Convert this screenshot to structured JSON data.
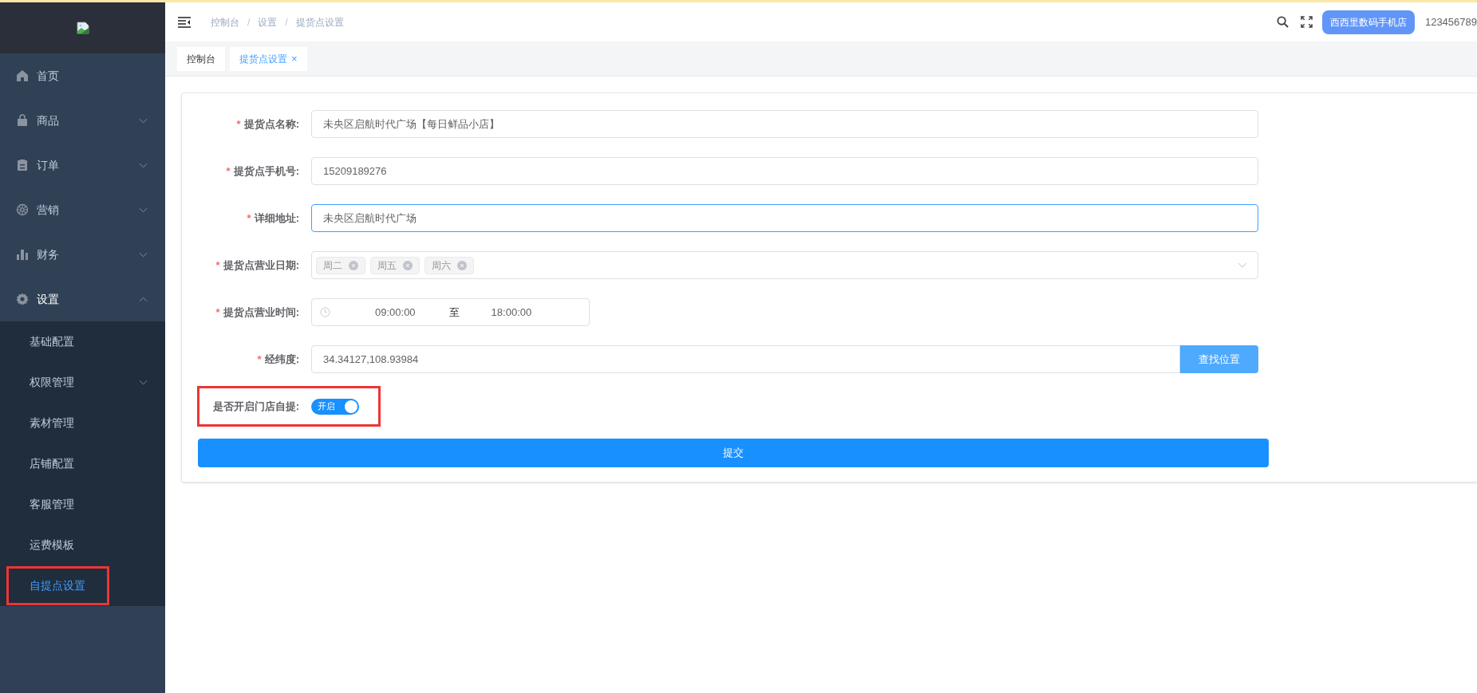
{
  "sidebar": {
    "logo": {
      "kind": "broken-image"
    },
    "items": [
      {
        "label": "首页"
      },
      {
        "label": "商品",
        "expanded": false
      },
      {
        "label": "订单",
        "expanded": false
      },
      {
        "label": "营销",
        "expanded": false
      },
      {
        "label": "财务",
        "expanded": false
      },
      {
        "label": "设置",
        "expanded": true,
        "children": [
          {
            "label": "基础配置",
            "selected": false
          },
          {
            "label": "权限管理",
            "selected": false,
            "expanded": false
          },
          {
            "label": "素材管理",
            "selected": false
          },
          {
            "label": "店铺配置",
            "selected": false
          },
          {
            "label": "客服管理",
            "selected": false
          },
          {
            "label": "运费模板",
            "selected": false
          },
          {
            "label": "自提点设置",
            "selected": true,
            "highlighted": true
          }
        ]
      }
    ]
  },
  "header": {
    "breadcrumb": [
      "控制台",
      "设置",
      "提货点设置"
    ],
    "breadcrumb_separator": "/",
    "shop_button": "西西里数码手机店",
    "username": "123456789"
  },
  "tabs": [
    {
      "label": "控制台",
      "selected": false
    },
    {
      "label": "提货点设置",
      "selected": true,
      "close": "×"
    }
  ],
  "form": {
    "fields": [
      {
        "kind": "text",
        "label": "提货点名称:",
        "required_mark": "*",
        "value": "未央区启航时代广场【每日鲜品小店】",
        "focused": false
      },
      {
        "kind": "text",
        "label": "提货点手机号:",
        "required_mark": "*",
        "value": "15209189276",
        "focused": false
      },
      {
        "kind": "text",
        "label": "详细地址:",
        "required_mark": "*",
        "value": "未央区启航时代广场",
        "focused": true
      },
      {
        "kind": "tags",
        "label": "提货点营业日期:",
        "required_mark": "*",
        "tags": [
          "周二",
          "周五",
          "周六"
        ]
      },
      {
        "kind": "timerange",
        "label": "提货点营业时间:",
        "required_mark": "*",
        "start": "09:00:00",
        "separator": "至",
        "end": "18:00:00"
      },
      {
        "kind": "search",
        "label": "经纬度:",
        "required_mark": "*",
        "value": "34.34127,108.93984",
        "button": "查找位置"
      },
      {
        "kind": "switch",
        "label": "是否开启门店自提:",
        "on": true,
        "on_text": "开启",
        "highlighted": true
      }
    ],
    "submit": "提交"
  }
}
